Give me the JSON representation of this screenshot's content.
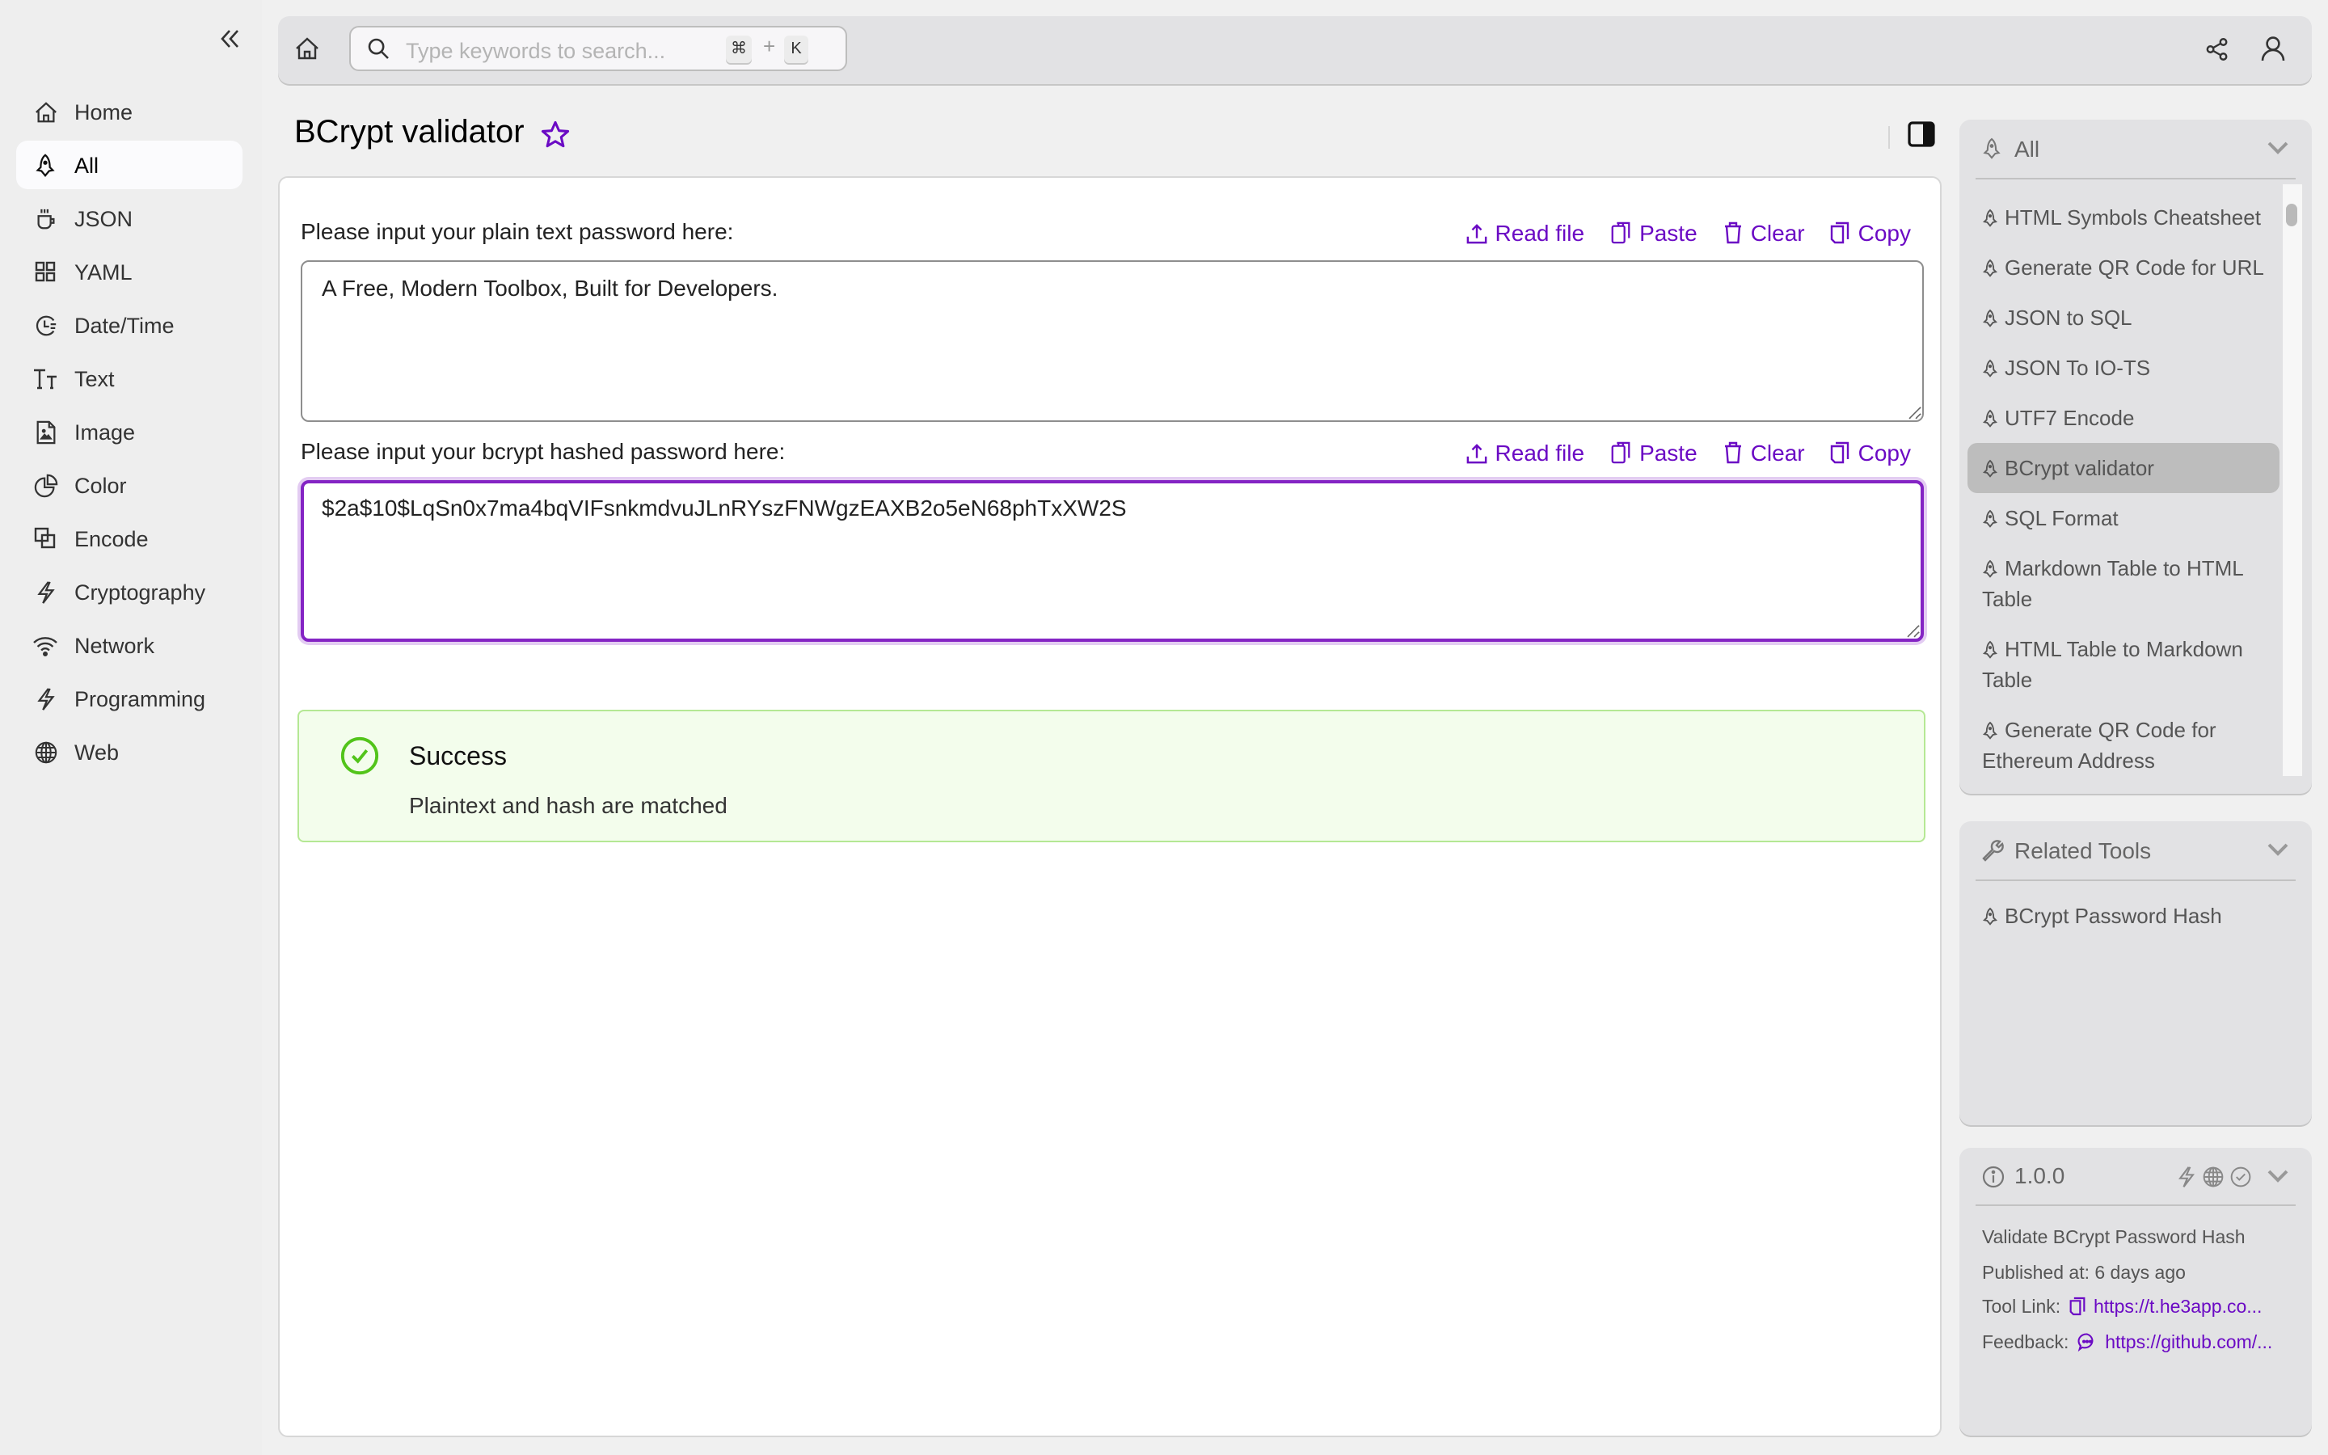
{
  "sidebar": {
    "collapse_icon": "double-chevron-left-icon",
    "items": [
      {
        "label": "Home",
        "icon": "home-icon",
        "active": false
      },
      {
        "label": "All",
        "icon": "rocket-icon",
        "active": true
      },
      {
        "label": "JSON",
        "icon": "cup-icon",
        "active": false
      },
      {
        "label": "YAML",
        "icon": "grid-icon",
        "active": false
      },
      {
        "label": "Date/Time",
        "icon": "clock-icon",
        "active": false
      },
      {
        "label": "Text",
        "icon": "text-size-icon",
        "active": false
      },
      {
        "label": "Image",
        "icon": "image-file-icon",
        "active": false
      },
      {
        "label": "Color",
        "icon": "pie-icon",
        "active": false
      },
      {
        "label": "Encode",
        "icon": "overlap-squares-icon",
        "active": false
      },
      {
        "label": "Cryptography",
        "icon": "lightning-icon",
        "active": false
      },
      {
        "label": "Network",
        "icon": "wifi-icon",
        "active": false
      },
      {
        "label": "Programming",
        "icon": "lightning-icon",
        "active": false
      },
      {
        "label": "Web",
        "icon": "globe-icon",
        "active": false
      }
    ]
  },
  "topbar": {
    "search_placeholder": "Type keywords to search...",
    "shortcut_mod": "⌘",
    "shortcut_plus": "+",
    "shortcut_key": "K"
  },
  "page": {
    "title": "BCrypt validator"
  },
  "form": {
    "actions": {
      "read_file": "Read file",
      "paste": "Paste",
      "clear": "Clear",
      "copy": "Copy"
    },
    "plain_label": "Please input your plain text password here:",
    "plain_value": "A Free, Modern Toolbox, Built for Developers.",
    "hash_label": "Please input your bcrypt hashed password here:",
    "hash_value": "$2a$10$LqSn0x7ma4bqVIFsnkmdvuJLnRYszFNWgzEAXB2o5eN68phTxXW2S"
  },
  "result": {
    "status": "success",
    "title": "Success",
    "message": "Plaintext and hash are matched"
  },
  "colors": {
    "accent": "#6b0ac4",
    "success_border": "#b5e894",
    "success_bg": "#f3fdec",
    "success_icon": "#52c41a"
  },
  "all_panel": {
    "title": "All",
    "items": [
      {
        "label": "HTML Symbols Cheatsheet",
        "active": false
      },
      {
        "label": "Generate QR Code for URL",
        "active": false
      },
      {
        "label": "JSON to SQL",
        "active": false
      },
      {
        "label": "JSON To IO-TS",
        "active": false
      },
      {
        "label": "UTF7 Encode",
        "active": false
      },
      {
        "label": "BCrypt validator",
        "active": true
      },
      {
        "label": "SQL Format",
        "active": false
      },
      {
        "label": "Markdown Table to HTML Table",
        "active": false
      },
      {
        "label": "HTML Table to Markdown Table",
        "active": false
      },
      {
        "label": "Generate QR Code for Ethereum Address",
        "active": false
      }
    ]
  },
  "related_panel": {
    "title": "Related Tools",
    "items": [
      {
        "label": "BCrypt Password Hash"
      }
    ]
  },
  "info_panel": {
    "version": "1.0.0",
    "description": "Validate BCrypt Password Hash",
    "published": "Published at: 6 days ago",
    "tool_link_label": "Tool Link:",
    "tool_link": "https://t.he3app.co...",
    "feedback_label": "Feedback:",
    "feedback_link": "https://github.com/..."
  }
}
